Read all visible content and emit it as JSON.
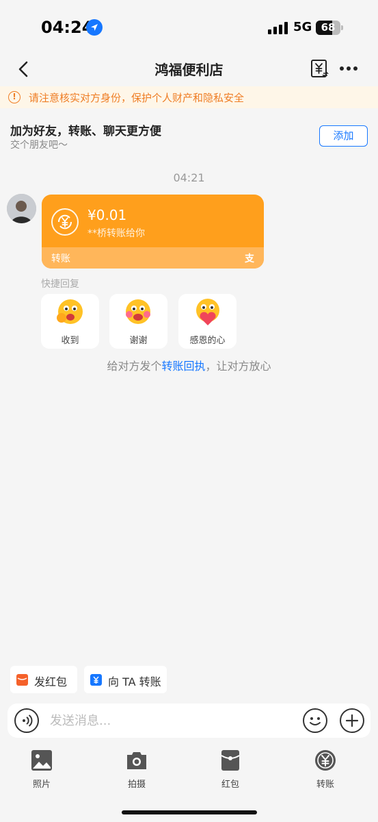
{
  "status_bar": {
    "time": "04:24",
    "network": "5G",
    "battery": "68",
    "battery_level": 0.68
  },
  "nav": {
    "title": "鸿福便利店"
  },
  "warning": {
    "text": "请注意核实对方身份，保护个人财产和隐私安全"
  },
  "friend_prompt": {
    "title": "加为好友，转账、聊天更方便",
    "subtitle": "交个朋友吧～",
    "add_button": "添加"
  },
  "message_time": "04:21",
  "transfer_card": {
    "amount": "¥0.01",
    "description": "**桥转账给你",
    "footer_label": "转账",
    "brand_glyph": "支",
    "color": "#ff9f1c"
  },
  "quick_reply": {
    "label": "快捷回复",
    "items": [
      {
        "label": "收到"
      },
      {
        "label": "谢谢"
      },
      {
        "label": "感恩的心"
      }
    ]
  },
  "receipt_tip": {
    "before": "给对方发个",
    "link": "转账回执",
    "after": "，让对方放心"
  },
  "chips": [
    {
      "label": "发红包",
      "color": "#f5612a"
    },
    {
      "label": "向 TA 转账",
      "color": "#1677ff"
    }
  ],
  "input": {
    "placeholder": "发送消息..."
  },
  "toolbar": [
    {
      "label": "照片",
      "icon": "photo-icon"
    },
    {
      "label": "拍摄",
      "icon": "camera-icon"
    },
    {
      "label": "红包",
      "icon": "red-packet-icon"
    },
    {
      "label": "转账",
      "icon": "transfer-icon"
    }
  ],
  "colors": {
    "accent": "#1677ff",
    "warning": "#ef7d24",
    "transfer": "#ff9f1c"
  }
}
